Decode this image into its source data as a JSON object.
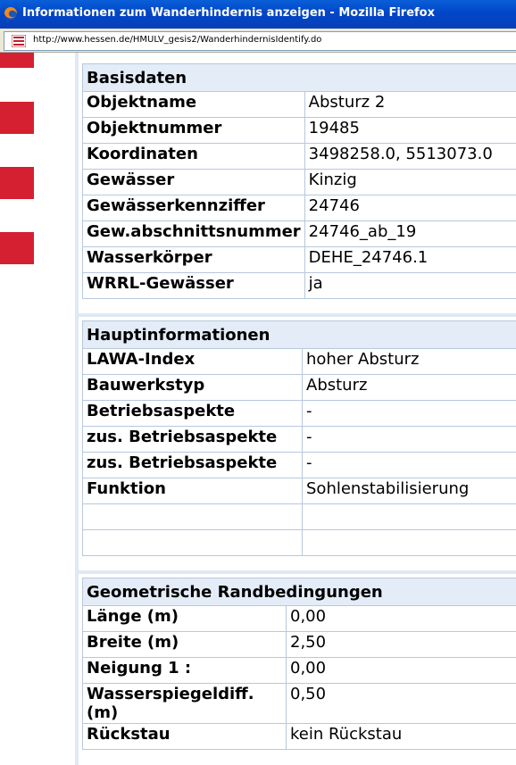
{
  "window": {
    "title": "Informationen zum Wanderhindernis anzeigen - Mozilla Firefox",
    "url": "http://www.hessen.de/HMULV_gesis2/WanderhindernisIdentify.do"
  },
  "sections": [
    {
      "header": "Basisdaten",
      "rows": [
        {
          "label": "Objektname",
          "value": "Absturz 2"
        },
        {
          "label": "Objektnummer",
          "value": "19485"
        },
        {
          "label": "Koordinaten",
          "value": "3498258.0, 5513073.0"
        },
        {
          "label": "Gewässer",
          "value": "Kinzig"
        },
        {
          "label": "Gewässerkennziffer",
          "value": "24746"
        },
        {
          "label": "Gew.abschnittsnummer",
          "value": "24746_ab_19"
        },
        {
          "label": "Wasserkörper",
          "value": "DEHE_24746.1"
        },
        {
          "label": "WRRL-Gewässer",
          "value": "ja"
        }
      ]
    },
    {
      "header": "Hauptinformationen",
      "rows": [
        {
          "label": "LAWA-Index",
          "value": "hoher Absturz"
        },
        {
          "label": "Bauwerkstyp",
          "value": "Absturz"
        },
        {
          "label": "Betriebsaspekte",
          "value": "-"
        },
        {
          "label": "zus. Betriebsaspekte",
          "value": "-"
        },
        {
          "label": "zus. Betriebsaspekte",
          "value": "-"
        },
        {
          "label": "Funktion",
          "value": "Sohlenstabilisierung"
        },
        {
          "label": "",
          "value": ""
        },
        {
          "label": "",
          "value": ""
        }
      ]
    },
    {
      "header": "Geometrische Randbedingungen",
      "rows": [
        {
          "label": "Länge (m)",
          "value": "0,00"
        },
        {
          "label": "Breite (m)",
          "value": "2,50"
        },
        {
          "label": "Neigung 1 :",
          "value": "0,00"
        },
        {
          "label": "Wasserspiegeldiff. (m)",
          "value": "0,50"
        },
        {
          "label": "Rückstau",
          "value": "kein Rückstau"
        }
      ]
    }
  ]
}
